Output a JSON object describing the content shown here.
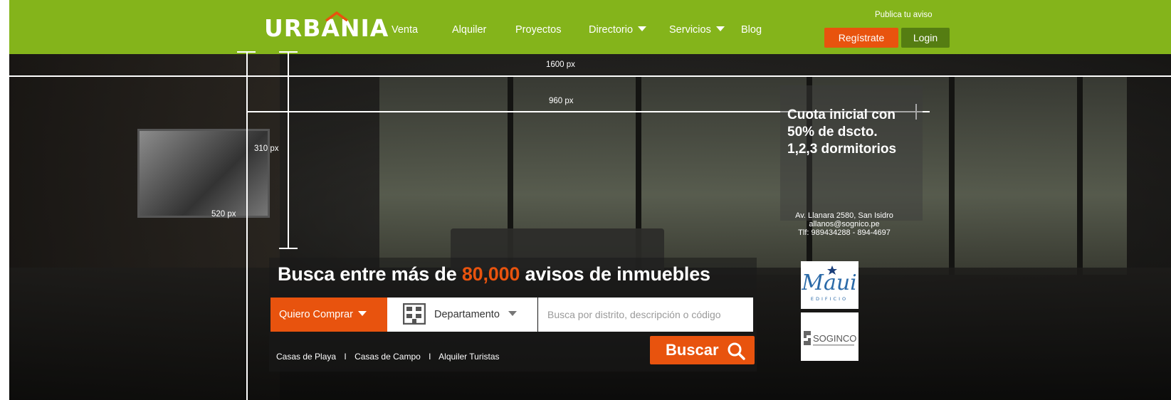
{
  "header": {
    "logo": "URBANIA",
    "nav": [
      "Venta",
      "Alquiler",
      "Proyectos",
      "Directorio",
      "Servicios",
      "Blog"
    ],
    "publica": "Publica tu aviso",
    "register": "Regístrate",
    "login": "Login"
  },
  "measures": {
    "w1600": "1600 px",
    "w960": "960 px",
    "h310": "310 px",
    "h520": "520 px"
  },
  "promo": {
    "lines": [
      "Cuota inicial con",
      "50% de dscto.",
      "1,2,3 dormitorios"
    ],
    "address": [
      "Av. Llanara 2580, San Isidro",
      "allanos@sognico.pe",
      "Tlf: 989434288 - 894-4697"
    ],
    "brand1": "Maui",
    "brand1_sub": "EDIFICIO",
    "brand2": "SOGINCO"
  },
  "search": {
    "title_pre": "Busca entre más de",
    "title_num": "80,000",
    "title_post": "avisos de inmuebles",
    "operation": "Quiero Comprar",
    "property_type": "Departamento",
    "placeholder": "Busca por distrito, descripción o código",
    "button": "Buscar",
    "quick_links": [
      "Casas de Playa",
      "Casas de Campo",
      "Alquiler Turistas"
    ],
    "separator": "I"
  },
  "colors": {
    "brand_green": "#84b41b",
    "accent_orange": "#e8530e",
    "login_green": "#557d12"
  }
}
